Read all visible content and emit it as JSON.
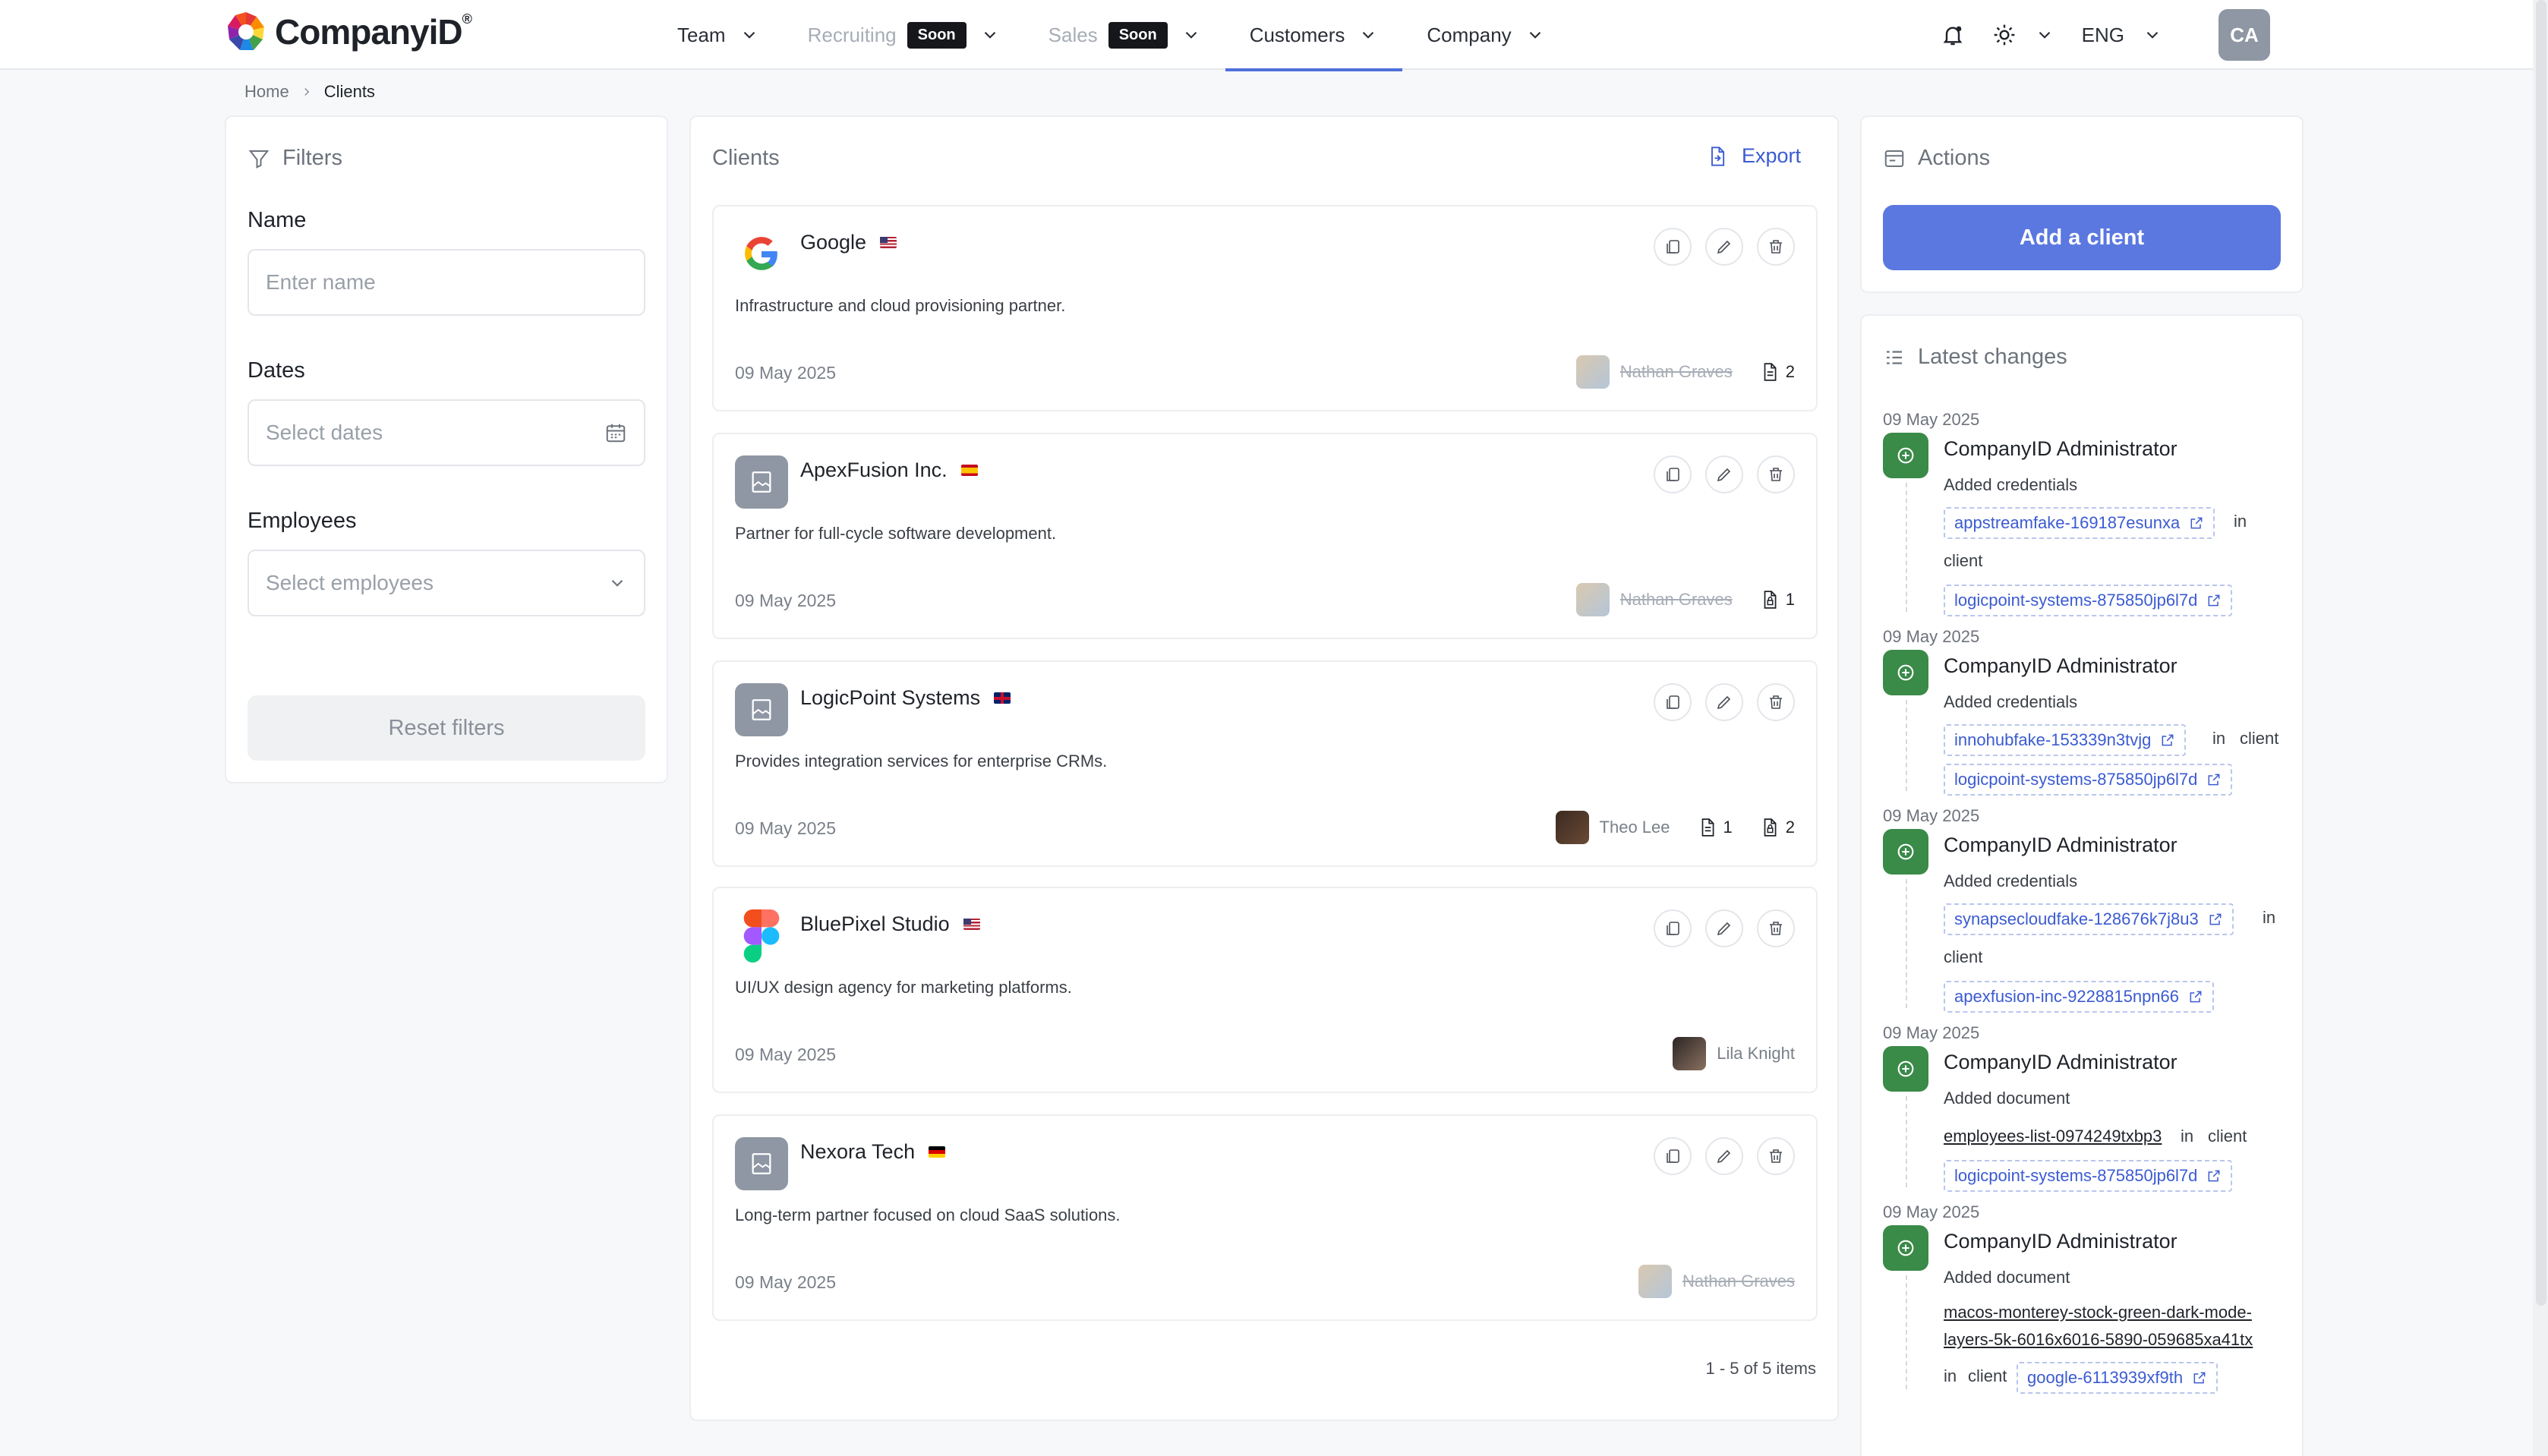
{
  "header": {
    "logo_text": "CompanyiD",
    "logo_mark": "®",
    "nav": [
      {
        "label": "Team",
        "badge": "",
        "disabled": false,
        "active": false
      },
      {
        "label": "Recruiting",
        "badge": "Soon",
        "disabled": true,
        "active": false
      },
      {
        "label": "Sales",
        "badge": "Soon",
        "disabled": true,
        "active": false
      },
      {
        "label": "Customers",
        "badge": "",
        "disabled": false,
        "active": true
      },
      {
        "label": "Company",
        "badge": "",
        "disabled": false,
        "active": false
      }
    ],
    "language": "ENG",
    "user_initials": "CA"
  },
  "breadcrumb": {
    "home": "Home",
    "current": "Clients"
  },
  "filters": {
    "title": "Filters",
    "name_label": "Name",
    "name_placeholder": "Enter name",
    "dates_label": "Dates",
    "dates_placeholder": "Select dates",
    "employees_label": "Employees",
    "employees_placeholder": "Select employees",
    "reset_label": "Reset filters"
  },
  "clients": {
    "title": "Clients",
    "export_label": "Export",
    "pagination": "1 - 5 of 5 items",
    "items": [
      {
        "name": "Google",
        "flag": "us",
        "description": "Infrastructure and cloud provisioning partner.",
        "date": "09 May 2025",
        "person": "Nathan Graves",
        "person_inactive": true,
        "docs": "2",
        "creds": ""
      },
      {
        "name": "ApexFusion Inc.",
        "flag": "es",
        "description": "Partner for full-cycle software development.",
        "date": "09 May 2025",
        "person": "Nathan Graves",
        "person_inactive": true,
        "docs": "",
        "creds": "1"
      },
      {
        "name": "LogicPoint Systems",
        "flag": "gb",
        "description": "Provides integration services for enterprise CRMs.",
        "date": "09 May 2025",
        "person": "Theo Lee",
        "person_inactive": false,
        "docs": "1",
        "creds": "2"
      },
      {
        "name": "BluePixel Studio",
        "flag": "us",
        "description": "UI/UX design agency for marketing platforms.",
        "date": "09 May 2025",
        "person": "Lila Knight",
        "person_inactive": false,
        "docs": "",
        "creds": ""
      },
      {
        "name": "Nexora Tech",
        "flag": "de",
        "description": "Long-term partner focused on cloud SaaS solutions.",
        "date": "09 May 2025",
        "person": "Nathan Graves",
        "person_inactive": true,
        "docs": "",
        "creds": ""
      }
    ]
  },
  "actions": {
    "title": "Actions",
    "add_label": "Add a client"
  },
  "changes": {
    "title": "Latest changes",
    "in_word": "in",
    "client_word": "client",
    "items": [
      {
        "date": "09 May 2025",
        "who": "CompanyID Administrator",
        "what": "Added credentials",
        "target": "appstreamfake-169187esunxa",
        "target_type": "chip",
        "client": "logicpoint-systems-875850jp6l7d"
      },
      {
        "date": "09 May 2025",
        "who": "CompanyID Administrator",
        "what": "Added credentials",
        "target": "innohubfake-153339n3tvjg",
        "target_type": "chip",
        "client": "logicpoint-systems-875850jp6l7d"
      },
      {
        "date": "09 May 2025",
        "who": "CompanyID Administrator",
        "what": "Added credentials",
        "target": "synapsecloudfake-128676k7j8u3",
        "target_type": "chip",
        "client": "apexfusion-inc-9228815npn66"
      },
      {
        "date": "09 May 2025",
        "who": "CompanyID Administrator",
        "what": "Added document",
        "target": "employees-list-0974249txbp3",
        "target_type": "link",
        "client": "logicpoint-systems-875850jp6l7d"
      },
      {
        "date": "09 May 2025",
        "who": "CompanyID Administrator",
        "what": "Added document",
        "target_line1": "macos-monterey-stock-green-dark-mode-",
        "target_line2": "layers-5k-6016x6016-5890-059685xa41tx",
        "target_type": "link",
        "client": "google-6113939xf9th"
      }
    ]
  },
  "colors": {
    "accent": "#4f6fdb",
    "primary_button": "#5b78e0",
    "success": "#3a8a48"
  }
}
